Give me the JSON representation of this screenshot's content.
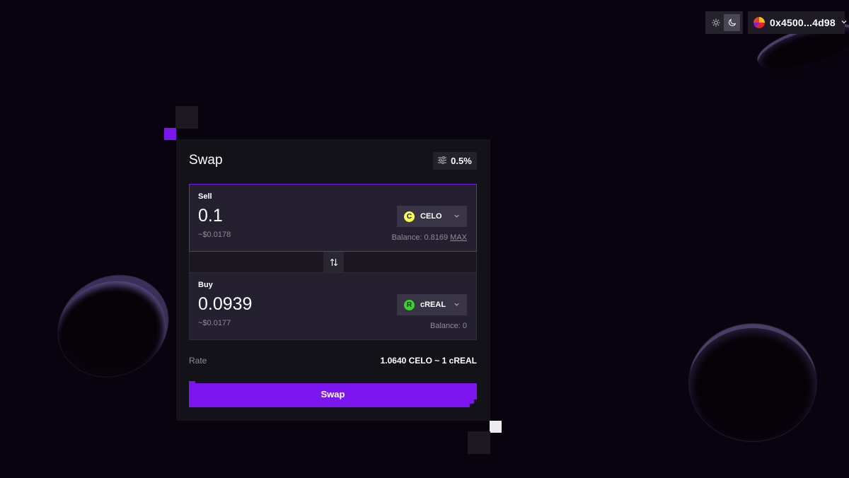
{
  "header": {
    "theme": {
      "light_icon": "sun-icon",
      "dark_icon": "moon-icon",
      "active": "dark"
    },
    "wallet": {
      "address": "0x4500...4d98",
      "avatar_icon": "wallet-avatar",
      "chevron_icon": "chevron-down-icon"
    }
  },
  "swap": {
    "title": "Swap",
    "slippage": {
      "icon": "sliders-icon",
      "value": "0.5%"
    },
    "sell": {
      "label": "Sell",
      "amount": "0.1",
      "usd": "~$0.0178",
      "token": "CELO",
      "token_icon": "celo-icon",
      "balance": "Balance: 0.8169",
      "max_label": "MAX"
    },
    "flip_icon": "swap-arrows-icon",
    "buy": {
      "label": "Buy",
      "amount": "0.0939",
      "usd": "~$0.0177",
      "token": "cREAL",
      "token_icon": "creal-icon",
      "balance": "Balance: 0"
    },
    "rate": {
      "label": "Rate",
      "value": "1.0640 CELO ~ 1 cREAL"
    },
    "button_label": "Swap"
  },
  "colors": {
    "background": "#08030f",
    "card": "#141219",
    "accent": "#7b17ee",
    "celo": "#fcff52",
    "creal": "#3bd12e"
  }
}
